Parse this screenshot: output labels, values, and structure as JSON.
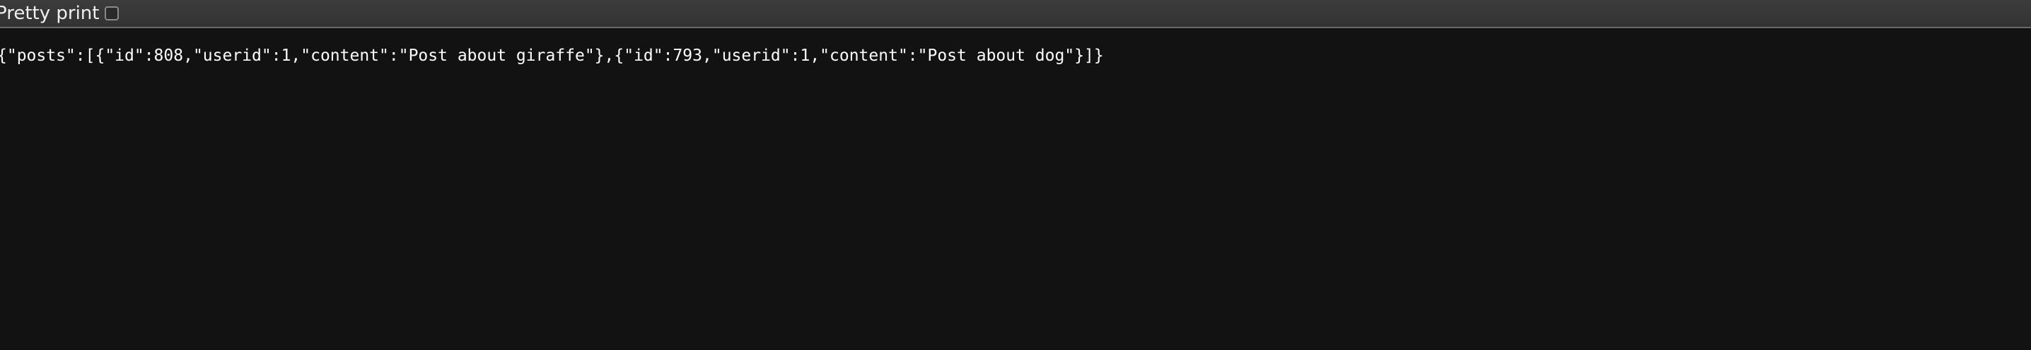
{
  "toolbar": {
    "pretty_print_label": "Pretty print",
    "pretty_print_checked": false
  },
  "content": {
    "raw_json": "{\"posts\":[{\"id\":808,\"userid\":1,\"content\":\"Post about giraffe\"},{\"id\":793,\"userid\":1,\"content\":\"Post about dog\"}]}"
  }
}
